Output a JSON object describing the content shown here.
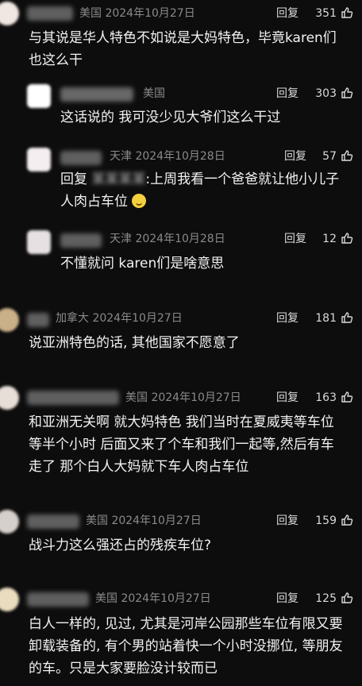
{
  "comments": [
    {
      "meta": "美国 2024年10月27日",
      "reply": "回复",
      "likes": "351",
      "text": "与其说是华人特色不如说是大妈特色，毕竟karen们也这么干"
    },
    {
      "meta": "美国",
      "reply": "回复",
      "likes": "303",
      "text": "这话说的 我可没少见大爷们这么干过"
    },
    {
      "meta": "天津 2024年10月28日",
      "reply": "回复",
      "likes": "57",
      "text_prefix": "回复",
      "text": ":上周我看一个爸爸就让他小儿子人肉占车位"
    },
    {
      "meta": "天津 2024年10月28日",
      "reply": "回复",
      "likes": "12",
      "text": "不懂就问 karen们是啥意思"
    },
    {
      "meta": "加拿大 2024年10月27日",
      "reply": "回复",
      "likes": "181",
      "text": "说亚洲特色的话, 其他国家不愿意了"
    },
    {
      "meta": "美国 2024年10月27日",
      "reply": "回复",
      "likes": "163",
      "text": "和亚洲无关啊 就大妈特色 我们当时在夏威夷等车位等半个小时 后面又来了个车和我们一起等,然后有车走了 那个白人大妈就下车人肉占车位"
    },
    {
      "meta": "美国 2024年10月27日",
      "reply": "回复",
      "likes": "159",
      "text": "战斗力这么强还占的残疾车位?"
    },
    {
      "meta": "美国 2024年10月27日",
      "reply": "回复",
      "likes": "125",
      "text": "白人一样的, 见过, 尤其是河岸公园那些车位有限又要卸载装备的, 有个男的站着快一个小时没挪位, 等朋友的车。只是大家要脸没计较而已"
    }
  ],
  "icons": {
    "like": "thumbs-up-icon"
  }
}
